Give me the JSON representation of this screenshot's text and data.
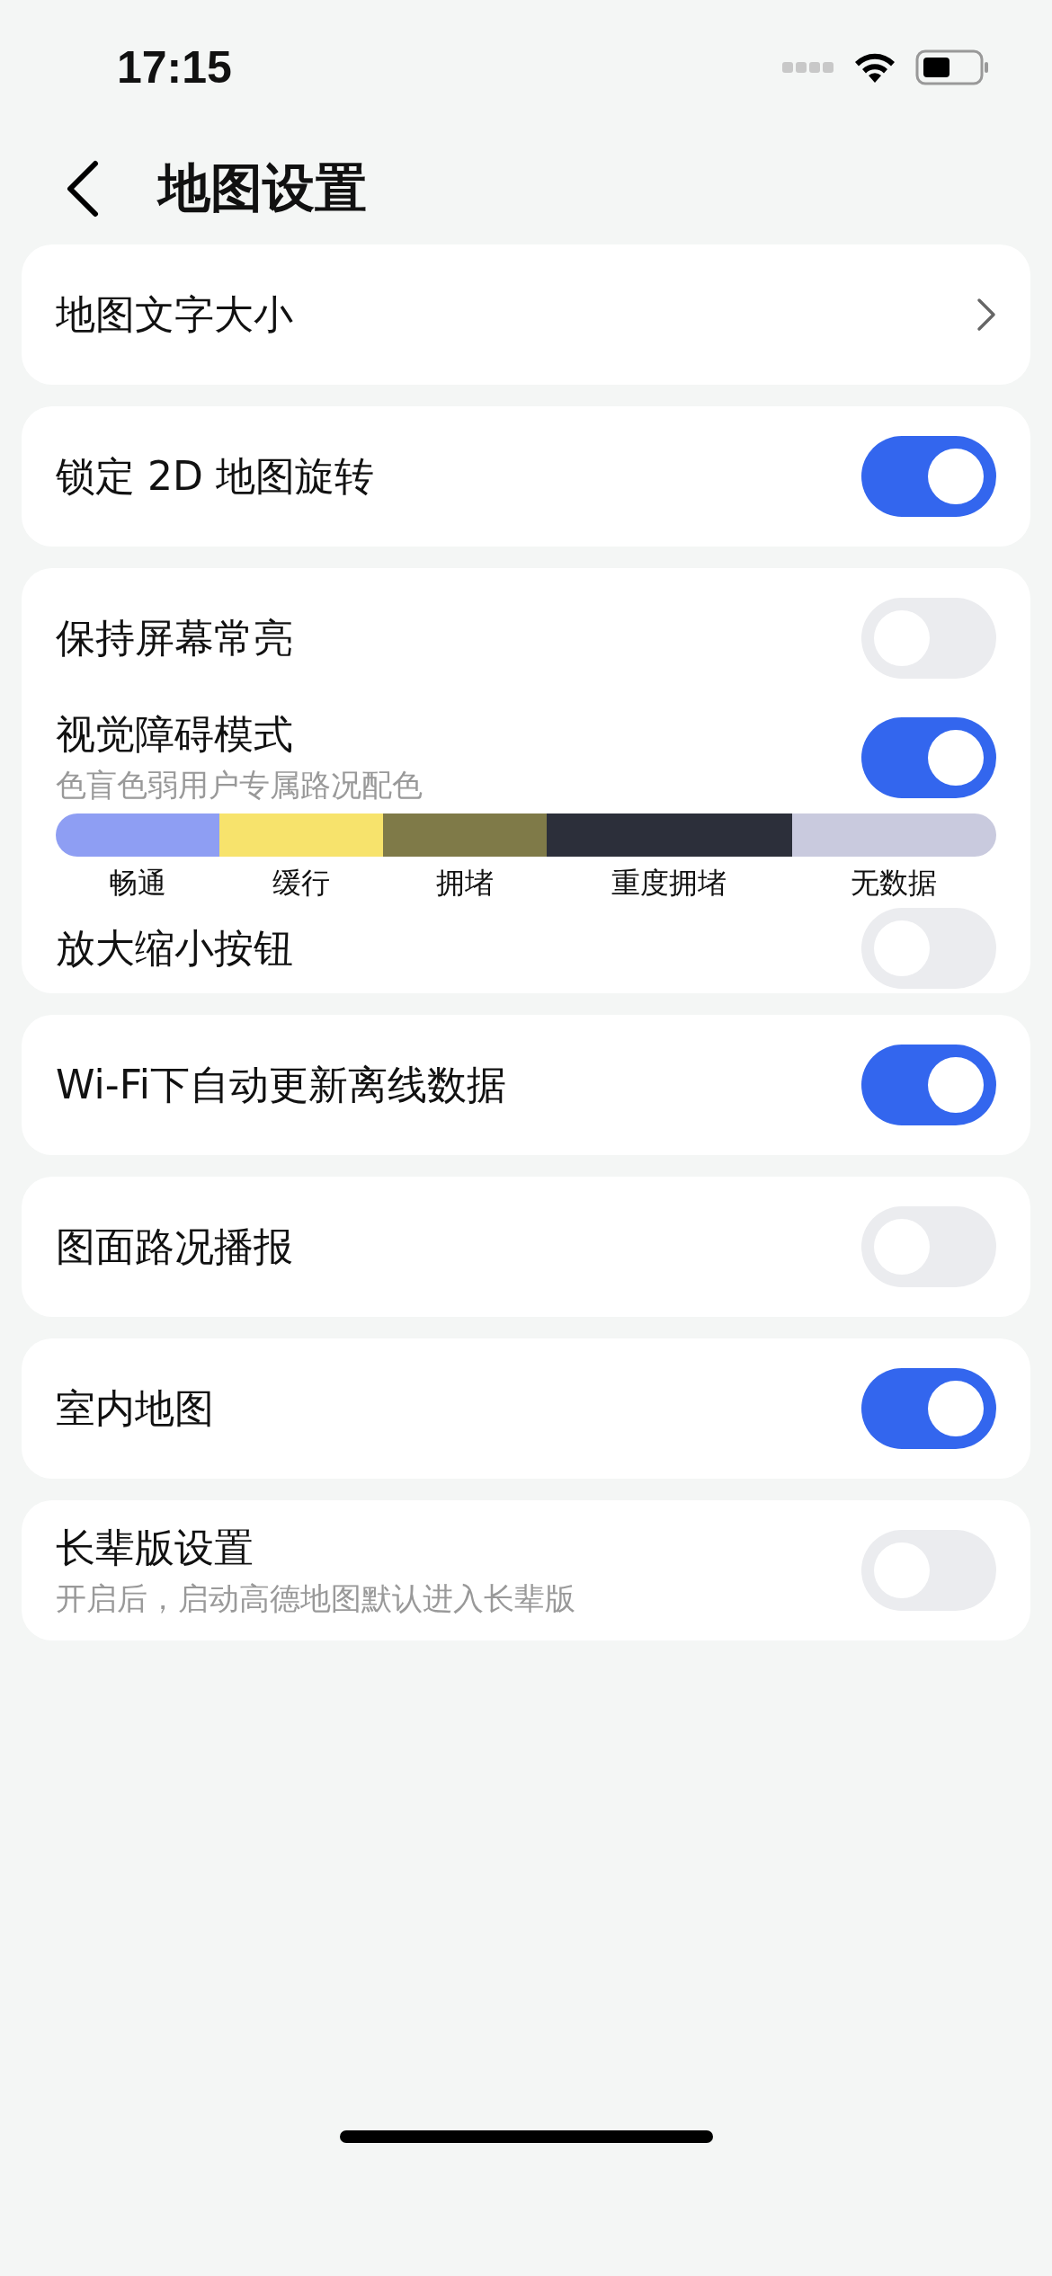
{
  "status_bar": {
    "time": "17:15"
  },
  "header": {
    "title": "地图设置"
  },
  "groups": [
    {
      "items": [
        {
          "kind": "link",
          "label": "地图文字大小"
        }
      ]
    },
    {
      "items": [
        {
          "kind": "toggle",
          "label": "锁定 2D 地图旋转",
          "on": true
        }
      ]
    },
    {
      "items": [
        {
          "kind": "toggle",
          "label": "保持屏幕常亮",
          "on": false
        },
        {
          "kind": "toggle",
          "label": "视觉障碍模式",
          "subtitle": "色盲色弱用户专属路况配色",
          "on": true
        },
        {
          "kind": "legend",
          "segments": [
            {
              "label": "畅通",
              "color": "#8e9ef3"
            },
            {
              "label": "缓行",
              "color": "#f7e36c"
            },
            {
              "label": "拥堵",
              "color": "#7f7a48"
            },
            {
              "label": "重度拥堵",
              "color": "#2c2f3a"
            },
            {
              "label": "无数据",
              "color": "#c9cade"
            }
          ]
        },
        {
          "kind": "toggle",
          "label": "放大缩小按钮",
          "on": false
        }
      ]
    },
    {
      "items": [
        {
          "kind": "toggle",
          "label": "Wi-Fi下自动更新离线数据",
          "on": true
        }
      ]
    },
    {
      "items": [
        {
          "kind": "toggle",
          "label": "图面路况播报",
          "on": false
        }
      ]
    },
    {
      "items": [
        {
          "kind": "toggle",
          "label": "室内地图",
          "on": true
        }
      ]
    },
    {
      "items": [
        {
          "kind": "toggle",
          "label": "长辈版设置",
          "subtitle": "开启后，启动高德地图默认进入长辈版",
          "on": false
        }
      ]
    }
  ]
}
